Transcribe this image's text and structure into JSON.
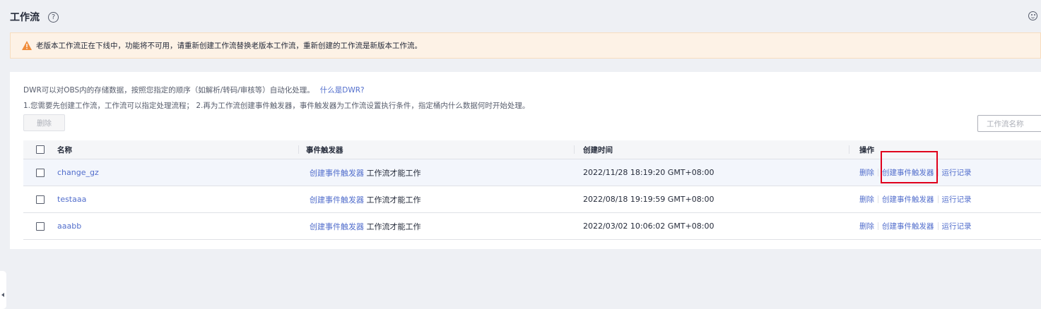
{
  "header": {
    "title": "工作流",
    "help_glyph": "?"
  },
  "alert": {
    "text": "老版本工作流正在下线中，功能将不可用，请重新创建工作流替换老版本工作流，重新创建的工作流是新版本工作流。"
  },
  "intro": {
    "line1": "DWR可以对OBS内的存储数据，按照您指定的顺序（如解析/转码/审核等）自动化处理。",
    "link": "什么是DWR?",
    "line2": "1.您需要先创建工作流，工作流可以指定处理流程； 2.再为工作流创建事件触发器，事件触发器为工作流设置执行条件，指定桶内什么数据何时开始处理。"
  },
  "toolbar": {
    "delete_label": "删除",
    "search_placeholder": "工作流名称"
  },
  "table": {
    "columns": [
      "名称",
      "事件触发器",
      "创建时间",
      "操作"
    ],
    "rows": [
      {
        "name": "change_gz",
        "trigger_link": "创建事件触发器",
        "trigger_text": "工作流才能工作",
        "created": "2022/11/28 18:19:20 GMT+08:00",
        "op_delete": "删除",
        "op_create": "创建事件触发器",
        "op_log": "运行记录"
      },
      {
        "name": "testaaa",
        "trigger_link": "创建事件触发器",
        "trigger_text": "工作流才能工作",
        "created": "2022/08/18 19:19:59 GMT+08:00",
        "op_delete": "删除",
        "op_create": "创建事件触发器",
        "op_log": "运行记录"
      },
      {
        "name": "aaabb",
        "trigger_link": "创建事件触发器",
        "trigger_text": "工作流才能工作",
        "created": "2022/03/02 10:06:02 GMT+08:00",
        "op_delete": "删除",
        "op_create": "创建事件触发器",
        "op_log": "运行记录"
      }
    ]
  },
  "icons": {
    "help": "help-icon",
    "feedback": "smile-icon",
    "warning": "warning-icon",
    "collapse": "collapse-left-icon"
  },
  "colors": {
    "link": "#526ecc",
    "warning": "#f08c3a",
    "highlight_box": "#e0001b",
    "alert_bg": "#fdf2e6"
  }
}
